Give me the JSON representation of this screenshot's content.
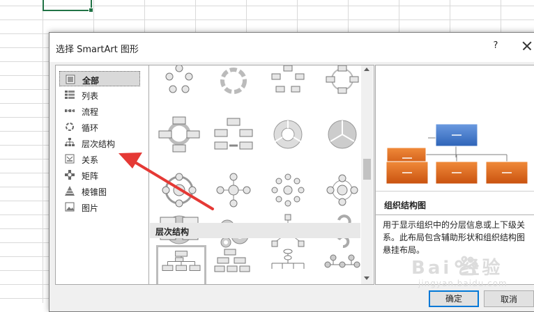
{
  "dialog": {
    "title": "选择 SmartArt 图形",
    "help_label": "?",
    "close_icon": "close-icon"
  },
  "categories": [
    {
      "label": "全部",
      "icon": "all-icon",
      "selected": true
    },
    {
      "label": "列表",
      "icon": "list-icon"
    },
    {
      "label": "流程",
      "icon": "process-icon"
    },
    {
      "label": "循环",
      "icon": "cycle-icon"
    },
    {
      "label": "层次结构",
      "icon": "hierarchy-icon"
    },
    {
      "label": "关系",
      "icon": "relationship-icon"
    },
    {
      "label": "矩阵",
      "icon": "matrix-icon"
    },
    {
      "label": "棱锥图",
      "icon": "pyramid-icon"
    },
    {
      "label": "图片",
      "icon": "picture-icon"
    }
  ],
  "gallery": {
    "section_header": "层次结构"
  },
  "preview": {
    "name": "组织结构图",
    "description": "用于显示组织中的分层信息或上下级关系。此布局包含辅助形状和组织结构图悬挂布局。",
    "colors": {
      "top": "#4a7fc9",
      "bottom": "#d9661e"
    }
  },
  "buttons": {
    "ok": "确定",
    "cancel": "取消"
  },
  "watermark": {
    "text": "Bai 经验",
    "url": "jingyan.baidu.com"
  }
}
